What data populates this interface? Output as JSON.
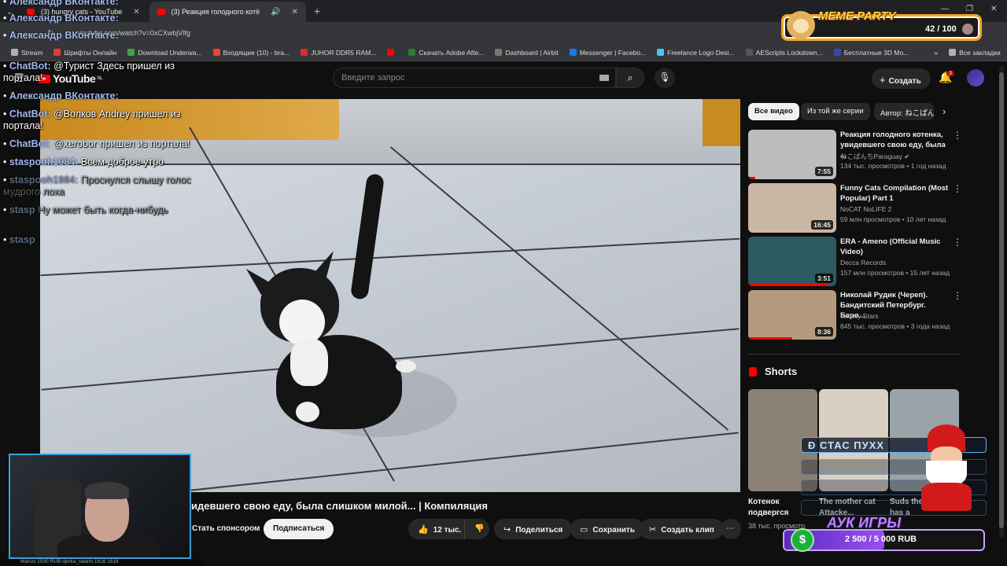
{
  "browser": {
    "tabs": [
      {
        "title": "(3) hungry cats - YouTube"
      },
      {
        "title": "(3) Реакция голодного котё"
      }
    ],
    "url": "youtube.com/watch?v=0xCXwbjVlfg",
    "bookmarks": [
      "Stream",
      "Шрифты Онлайн",
      "Download Underwa...",
      "Входящие (10) - bra...",
      "JUHOR DDR5 RAM...",
      "Скачать Adobe Afte...",
      "Dashboard | Airbit",
      "Messenger | Facebo...",
      "Freelance Logo Desi...",
      "AEScripts Lockdown...",
      "Бесплатные 3D Мо..."
    ],
    "all_bookmarks": "Все закладки"
  },
  "youtube": {
    "logo": "YouTube",
    "logo_region": "NL",
    "search_placeholder": "Введите запрос",
    "create_label": "Создать",
    "notifications_count": "3"
  },
  "video": {
    "title_visible": "идевшего свою еду, была слишком милой... | Компиляция",
    "actions": {
      "sponsor": "Стать спонсором",
      "subscribe": "Подписаться",
      "likes": "12 тыс.",
      "share": "Поделиться",
      "save": "Сохранить",
      "clip": "Создать клип"
    }
  },
  "chips": [
    "Все видео",
    "Из той же серии",
    "Автор: ねこぱん"
  ],
  "recommendations": [
    {
      "title": "Реакция голодного котенка, увидевшего свою еду, была ...",
      "channel": "ねこぱんちParaguay",
      "verified": true,
      "meta": "134 тыс. просмотров • 1 год назад",
      "duration": "7:55",
      "progress": 0.08,
      "thumb_color": "#bdbdbd"
    },
    {
      "title": "Funny Cats Compilation (Most Popular) Part 1",
      "channel": "NoCAT NoLIFE 2",
      "verified": false,
      "meta": "59 млн просмотров • 10 лет назад",
      "duration": "16:45",
      "progress": 0,
      "thumb_color": "#c9b7a4"
    },
    {
      "title": "ERA - Ameno (Official Music Video)",
      "channel": "Decca Records",
      "verified": false,
      "meta": "157 млн просмотров • 15 лет назад",
      "duration": "3:51",
      "progress": 0.9,
      "thumb_color": "#2c5a60"
    },
    {
      "title": "Николай Рудик (Череп). Бандитский Петербург. Баро...",
      "channel": "History Stars",
      "verified": false,
      "meta": "845 тыс. просмотров • 3 года назад",
      "duration": "8:36",
      "progress": 0.5,
      "thumb_color": "#b59a80"
    }
  ],
  "shorts": {
    "heading": "Shorts",
    "items": [
      {
        "title": "Котенок подвергся",
        "meta": "38 тыс. просмотр",
        "thumb_color": "#8b8074"
      },
      {
        "title": "The mother cat Attacke...",
        "meta": "",
        "thumb_color": "#d9d0c4"
      },
      {
        "title": "Suds the kitten has a",
        "meta": "",
        "thumb_color": "#9aa3a8"
      }
    ]
  },
  "chat": [
    {
      "name": "Александр ВКонтакте:",
      "text": "",
      "faded": false
    },
    {
      "name": "Александр ВКонтакте:",
      "text": "",
      "faded": false
    },
    {
      "name": "Александр ВКонтакте:",
      "text": "",
      "faded": false
    },
    {
      "name": "ChatBot:",
      "text": "@Турист Здесь пришел из портала!",
      "faded": false
    },
    {
      "name": "Александр ВКонтакте:",
      "text": "",
      "faded": false
    },
    {
      "name": "ChatBot:",
      "text": "@Волков Andrey пришел из портала!",
      "faded": false
    },
    {
      "name": "ChatBot:",
      "text": "@xerobor пришел из портала!",
      "faded": false
    },
    {
      "name": "staspooh1984:",
      "text": "Всем доброе утро",
      "faded": false
    },
    {
      "name": "staspooh1984:",
      "text": "Проснулся слышу голос мудрого лоха",
      "faded": true
    },
    {
      "name": "stasp",
      "text": "Ну может быть когда-нибудь",
      "faded": true
    },
    {
      "name": "stasp",
      "text": "",
      "faded": true
    }
  ],
  "overlay": {
    "meme_party_title": "MEME PARTY",
    "meme_party_count": "42 / 100",
    "donor_name": "СТАС ПУХХ",
    "auction_title": "АУК ИГРЫ",
    "auction_amount": "2 500 / 5 000 RUB",
    "auction_progress": 0.5,
    "webcam_strip": "Marius 1500 RUB      djmka_tatarin 1616 1616"
  },
  "colors": {
    "yt_red": "#ff0000",
    "bg": "#0f0f0f",
    "chip": "#272727"
  }
}
